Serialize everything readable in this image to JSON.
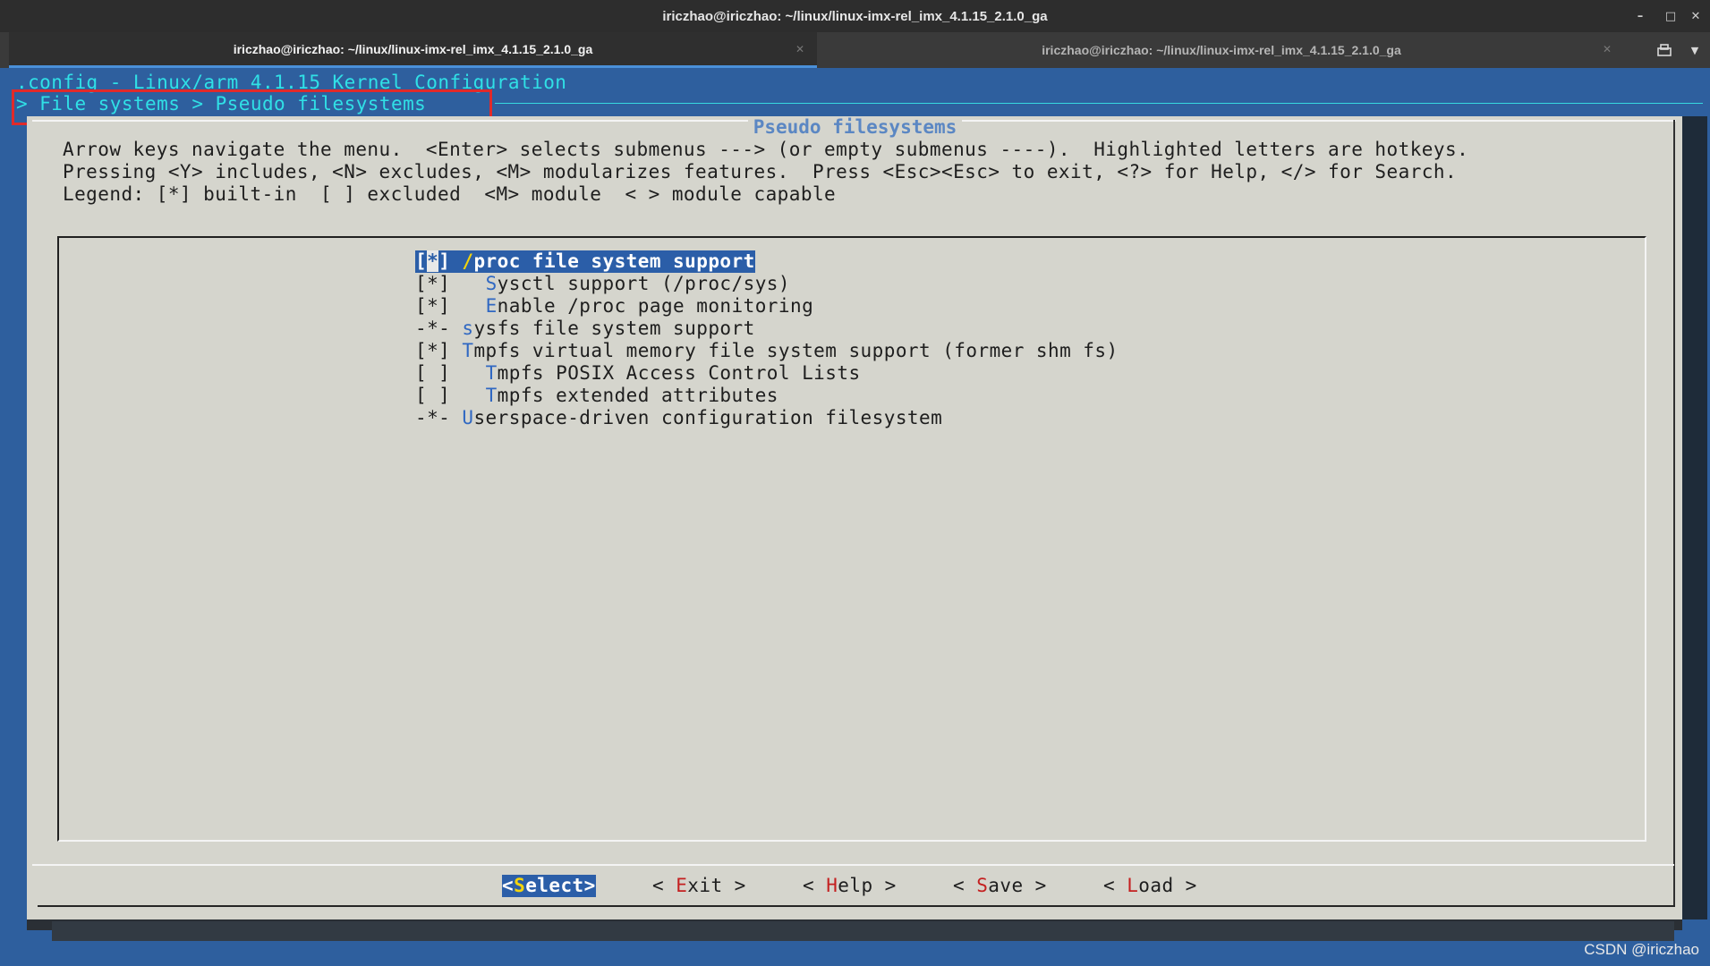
{
  "window": {
    "title": "iriczhao@iriczhao: ~/linux/linux-imx-rel_imx_4.1.15_2.1.0_ga"
  },
  "tabs": [
    {
      "label": "iriczhao@iriczhao: ~/linux/linux-imx-rel_imx_4.1.15_2.1.0_ga",
      "active": true
    },
    {
      "label": "iriczhao@iriczhao: ~/linux/linux-imx-rel_imx_4.1.15_2.1.0_ga",
      "active": false
    }
  ],
  "terminal": {
    "config_title": ".config - Linux/arm 4.1.15 Kernel Configuration",
    "breadcrumb": "> File systems > Pseudo filesystems"
  },
  "dialog": {
    "title": "Pseudo filesystems",
    "help_lines": [
      "Arrow keys navigate the menu.  <Enter> selects submenus ---> (or empty submenus ----).  Highlighted letters are hotkeys.",
      "Pressing <Y> includes, <N> excludes, <M> modularizes features.  Press <Esc><Esc> to exit, <?> for Help, </> for Search.",
      "Legend: [*] built-in  [ ] excluded  <M> module  < > module capable"
    ],
    "menu_items": [
      {
        "indicator": "[*]",
        "pad": " ",
        "hotkey": "/",
        "rest": "proc file system support",
        "selected": true
      },
      {
        "indicator": "[*]",
        "pad": "   ",
        "hotkey": "S",
        "rest": "ysctl support (/proc/sys)",
        "selected": false
      },
      {
        "indicator": "[*]",
        "pad": "   ",
        "hotkey": "E",
        "rest": "nable /proc page monitoring",
        "selected": false
      },
      {
        "indicator": "-*-",
        "pad": " ",
        "hotkey": "s",
        "rest": "ysfs file system support",
        "selected": false
      },
      {
        "indicator": "[*]",
        "pad": " ",
        "hotkey": "T",
        "rest": "mpfs virtual memory file system support (former shm fs)",
        "selected": false
      },
      {
        "indicator": "[ ]",
        "pad": "   ",
        "hotkey": "T",
        "rest": "mpfs POSIX Access Control Lists",
        "selected": false
      },
      {
        "indicator": "[ ]",
        "pad": "   ",
        "hotkey": "T",
        "rest": "mpfs extended attributes",
        "selected": false
      },
      {
        "indicator": "-*-",
        "pad": " ",
        "hotkey": "U",
        "rest": "serspace-driven configuration filesystem",
        "selected": false
      }
    ],
    "buttons": [
      {
        "left": "<",
        "hotkey": "S",
        "rest": "elect",
        "right": ">",
        "selected": true
      },
      {
        "left": "< ",
        "hotkey": "E",
        "rest": "xit",
        "right": " >",
        "selected": false
      },
      {
        "left": "< ",
        "hotkey": "H",
        "rest": "elp",
        "right": " >",
        "selected": false
      },
      {
        "left": "< ",
        "hotkey": "S",
        "rest": "ave",
        "right": " >",
        "selected": false
      },
      {
        "left": "< ",
        "hotkey": "L",
        "rest": "oad",
        "right": " >",
        "selected": false
      }
    ]
  },
  "watermark": "CSDN @iriczhao",
  "colors": {
    "terminal_bg": "#2e5f9e",
    "dialog_bg": "#d5d5cd",
    "highlight": "#2b5ea8",
    "hotkey": "#3068c2",
    "title_cyan": "#30e0e6",
    "annotation_red": "#e12a2a"
  }
}
